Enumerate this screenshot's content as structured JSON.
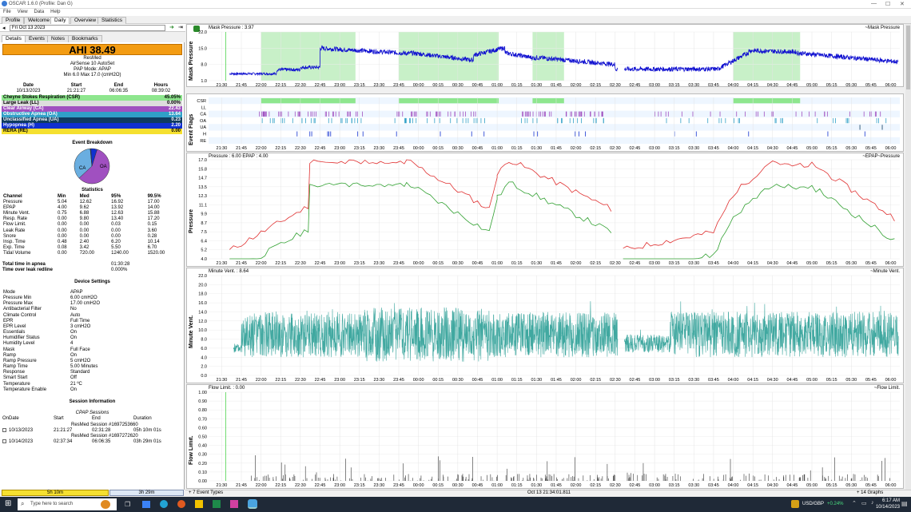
{
  "window": {
    "title": "OSCAR 1.6.0 (Profile: Dan G)"
  },
  "menu": [
    "File",
    "View",
    "Data",
    "Help"
  ],
  "tabs": [
    "Profile",
    "Welcome",
    "Daily",
    "Overview",
    "Statistics"
  ],
  "date": "Fri Oct 13 2023",
  "subtabs": [
    "Details",
    "Events",
    "Notes",
    "Bookmarks"
  ],
  "ahi": "AHI 38.49",
  "machine": {
    "brand": "ResMed",
    "model": "AirSense 10 AutoSet",
    "mode": "PAP Mode: APAP",
    "pressure": "Min 6.0 Max 17.0 (cmH2O)"
  },
  "session_head": {
    "h": [
      "Date",
      "Start",
      "End",
      "Hours"
    ],
    "v": [
      "10/13/2023",
      "21:21:27",
      "06:06:35",
      "08:39:02"
    ]
  },
  "events": [
    {
      "name": "Cheyne Stokes Respiration (CSR)",
      "value": "45.05%",
      "bg": "#8ee68e",
      "fg": "#000"
    },
    {
      "name": "Large Leak (LL)",
      "value": "0.00%",
      "bg": "#dddddd",
      "fg": "#000"
    },
    {
      "name": "Clear Airway (CA)",
      "value": "22.43",
      "bg": "#a050c0",
      "fg": "#fff"
    },
    {
      "name": "Obstructive Apnea (OA)",
      "value": "13.64",
      "bg": "#30a0c8",
      "fg": "#fff"
    },
    {
      "name": "Unclassified Apnea (UA)",
      "value": "0.23",
      "bg": "#0f3b60",
      "fg": "#fff"
    },
    {
      "name": "Hypopnea (H)",
      "value": "2.20",
      "bg": "#1030d0",
      "fg": "#fff"
    },
    {
      "name": "RERA (RE)",
      "value": "0.00",
      "bg": "#f5e030",
      "fg": "#000"
    }
  ],
  "breakdown": {
    "title": "Event Breakdown",
    "ca_label": "CA",
    "oa_label": "OA",
    "slices": [
      {
        "label": "CA",
        "value": 22.43,
        "color": "#a050c0"
      },
      {
        "label": "OA",
        "value": 13.64,
        "color": "#6aaee0"
      },
      {
        "label": "UA",
        "value": 0.23,
        "color": "#0f3b60"
      },
      {
        "label": "H",
        "value": 2.2,
        "color": "#1030d0"
      }
    ]
  },
  "statistics": {
    "title": "Statistics",
    "headers": [
      "Channel",
      "Min",
      "Med",
      "95%",
      "99.5%"
    ],
    "rows": [
      [
        "Pressure",
        "5.04",
        "12.62",
        "16.92",
        "17.00"
      ],
      [
        "EPAP",
        "4.00",
        "9.62",
        "13.92",
        "14.00"
      ],
      [
        "Minute Vent.",
        "0.75",
        "6.88",
        "12.63",
        "15.88"
      ],
      [
        "Resp. Rate",
        "0.00",
        "9.80",
        "13.40",
        "17.20"
      ],
      [
        "Flow Limit.",
        "0.00",
        "0.00",
        "0.03",
        "0.15"
      ],
      [
        "Leak Rate",
        "0.00",
        "0.00",
        "0.00",
        "3.60"
      ],
      [
        "Snore",
        "0.00",
        "0.00",
        "0.00",
        "0.28"
      ],
      [
        "Insp. Time",
        "0.48",
        "2.40",
        "6.20",
        "10.14"
      ],
      [
        "Exp. Time",
        "0.08",
        "3.42",
        "5.50",
        "6.70"
      ],
      [
        "Tidal Volume",
        "0.00",
        "720.00",
        "1240.00",
        "1520.00"
      ]
    ]
  },
  "apnea": {
    "label1": "Total time in apnea",
    "value1": "01:30:28",
    "label2": "Time over leak redline",
    "value2": "0.000%"
  },
  "device": {
    "title": "Device Settings",
    "rows": [
      [
        "Mode",
        "APAP"
      ],
      [
        "Pressure Min",
        "6.00 cmH2O"
      ],
      [
        "Pressure Max",
        "17.00 cmH2O"
      ],
      [
        "Antibacterial Filter",
        "No"
      ],
      [
        "Climate Control",
        "Auto"
      ],
      [
        "EPR",
        "Full Time"
      ],
      [
        "EPR Level",
        "3 cmH2O"
      ],
      [
        "Essentials",
        "On"
      ],
      [
        "Humidifier Status",
        "On"
      ],
      [
        "Humidity Level",
        "4"
      ],
      [
        "Mask",
        "Full Face"
      ],
      [
        "Ramp",
        "On"
      ],
      [
        "Ramp Pressure",
        "5 cmH2O"
      ],
      [
        "Ramp Time",
        "5.00 Minutes"
      ],
      [
        "Response",
        "Standard"
      ],
      [
        "Smart Start",
        "Off"
      ],
      [
        "Temperature",
        "21 ºC"
      ],
      [
        "Temperature Enable",
        "On"
      ]
    ]
  },
  "sessions": {
    "title": "Session Information",
    "subtitle": "CPAP Sessions",
    "headers": [
      "OnDate",
      "Start",
      "End",
      "Duration"
    ],
    "rows": [
      {
        "id": "ResMed Session #1697253660",
        "date": "10/13/2023",
        "start": "21:21:27",
        "end": "02:31:28",
        "dur": "05h 10m 01s"
      },
      {
        "id": "ResMed Session #1697272620",
        "date": "10/14/2023",
        "start": "02:37:34",
        "end": "06:06:35",
        "dur": "03h 29m 01s"
      }
    ]
  },
  "bottom": {
    "seg1": "5h 10m",
    "seg2": "3h 29m"
  },
  "status": {
    "events": "7 Event Types",
    "time": "Oct 13 21:34:01.811",
    "graphs": "14 Graphs"
  },
  "graphs": {
    "mask": {
      "ylabel": "Mask Pressure",
      "title": "Mask Pressure : 3.97",
      "legend": "~Mask Pressure",
      "ticks": [
        "22.0",
        "15.0",
        "8.0",
        "1.0"
      ]
    },
    "flags": {
      "ylabel": "Event Flags",
      "rows": [
        "CSR",
        "LL",
        "CA",
        "OA",
        "UA",
        "H",
        "RE"
      ]
    },
    "pressure": {
      "ylabel": "Pressure",
      "title": "Pressure : 6.00 EPAP : 4.00",
      "legend": "~EPAP~Pressure",
      "ticks": [
        "17.0",
        "15.8",
        "14.7",
        "13.5",
        "12.3",
        "11.1",
        "9.9",
        "8.7",
        "7.5",
        "6.4",
        "5.2",
        "4.0"
      ]
    },
    "mv": {
      "ylabel": "Minute Vent.",
      "title": "Minute Vent. : 8.64",
      "legend": "~Minute Vent.",
      "ticks": [
        "22.0",
        "20.0",
        "18.0",
        "16.0",
        "14.0",
        "12.0",
        "10.0",
        "8.0",
        "6.0",
        "4.0",
        "2.0",
        "0.0"
      ]
    },
    "fl": {
      "ylabel": "Flow Limit.",
      "title": "Flow Limit. : 0.00",
      "legend": "~Flow Limit.",
      "ticks": [
        "1.00",
        "0.90",
        "0.80",
        "0.70",
        "0.60",
        "0.50",
        "0.40",
        "0.30",
        "0.20",
        "0.10",
        "0.00"
      ]
    }
  },
  "time_ticks": [
    "21:30",
    "21:45",
    "22:00",
    "22:15",
    "22:30",
    "22:45",
    "23:00",
    "23:15",
    "23:30",
    "23:45",
    "00:00",
    "00:15",
    "00:30",
    "00:45",
    "01:00",
    "01:15",
    "01:30",
    "01:45",
    "02:00",
    "02:15",
    "02:30",
    "02:45",
    "03:00",
    "03:15",
    "03:30",
    "03:45",
    "04:00",
    "04:15",
    "04:30",
    "04:45",
    "05:00",
    "05:15",
    "05:30",
    "05:45",
    "06:00"
  ],
  "taskbar": {
    "search": "Type here to search",
    "currency": "USD/GBP",
    "change": "+0.24%",
    "time": "6:17 AM",
    "date": "10/14/2023"
  },
  "colors": {
    "ahi": "#f39c12",
    "csr": "#8ee68e",
    "mask": "#1010d0",
    "pressure": "#e03030",
    "epap": "#30a030",
    "mv": "#40a8a0",
    "fl": "#333333"
  }
}
